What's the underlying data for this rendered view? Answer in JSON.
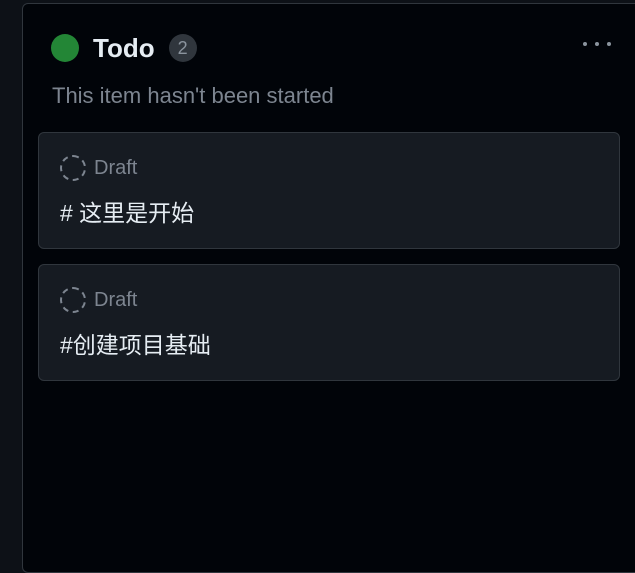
{
  "column": {
    "title": "Todo",
    "count": "2",
    "description": "This item hasn't been started",
    "status_color": "#238636",
    "more_icon": "kebab-horizontal-icon"
  },
  "cards": [
    {
      "type_label": "Draft",
      "title": "# 这里是开始",
      "icon": "draft-issue-icon"
    },
    {
      "type_label": "Draft",
      "title": "#创建项目基础",
      "icon": "draft-issue-icon"
    }
  ]
}
